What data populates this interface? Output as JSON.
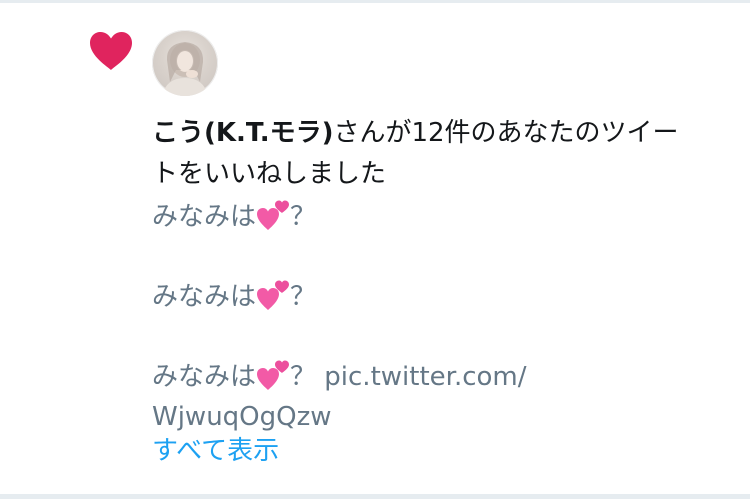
{
  "notification": {
    "type": "like",
    "user_name": "こう(K.T.モラ)",
    "headline_rest_line1": "さんが12件のあなたのツイー",
    "headline_rest_line2": "トをいいねしました",
    "tweets": [
      {
        "text": "みなみは",
        "emoji": "two-hearts-emoji",
        "suffix": "？"
      },
      {
        "text": "みなみは",
        "emoji": "two-hearts-emoji",
        "suffix": "？"
      },
      {
        "text": "みなみは",
        "emoji": "two-hearts-emoji",
        "suffix": "？ pic.twitter.com/",
        "continuation": "WjwuqOgQzw"
      }
    ],
    "show_all_label": "すべて表示"
  },
  "colors": {
    "heart": "#e0245e",
    "primary_text": "#14171a",
    "secondary_text": "#657786",
    "link": "#1da1f2",
    "divider": "#e6ecf0",
    "emoji_pink": "#f25aa6"
  },
  "icons": {
    "like": "heart-icon",
    "avatar": "user-avatar",
    "emoji": "two-hearts-emoji"
  }
}
